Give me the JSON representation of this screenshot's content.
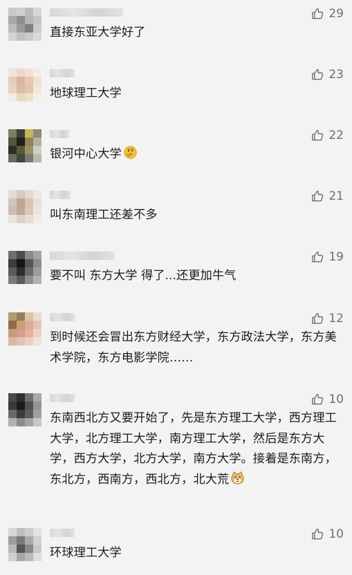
{
  "comments": [
    {
      "text": "直接东亚大学好了",
      "likes": "29",
      "emoji": "",
      "avatar": [
        "#c9c9c9",
        "#cfcfcf",
        "#bdbdbd",
        "#d6d6d6",
        "#a9a9a9",
        "#8f8f8f",
        "#b5b5b5",
        "#c4c4c4",
        "#bcbcbc",
        "#9a9a9a",
        "#7f7f7f",
        "#cdcdcd",
        "#d4d4d4",
        "#c1c1c1",
        "#cacaca",
        "#dadada"
      ]
    },
    {
      "text": "地球理工大学",
      "likes": "23",
      "emoji": "",
      "avatar": [
        "#f1e4d6",
        "#efd8c8",
        "#f3e1d3",
        "#f5ece2",
        "#e8ccb8",
        "#d9b39c",
        "#e6c9b3",
        "#f1e0d1",
        "#ecd3c0",
        "#dcbaa3",
        "#e3c4ad",
        "#f2e6da",
        "#f4ebe2",
        "#ead6c5",
        "#efdfcf",
        "#f6efe7"
      ]
    },
    {
      "text": "银河中心大学",
      "likes": "22",
      "emoji": "thinking-emoji",
      "avatar": [
        "#7b7b68",
        "#3e3e35",
        "#c9b65c",
        "#8a8a7a",
        "#55553f",
        "#1f1f18",
        "#8c8455",
        "#b1b1a0",
        "#2e2e25",
        "#5a5a3a",
        "#9a9160",
        "#cfcfc4",
        "#6a6a60",
        "#444438",
        "#7a7a6e",
        "#b8b8ad"
      ]
    },
    {
      "text": "叫东南理工还差不多",
      "likes": "21",
      "emoji": "",
      "avatar": [
        "#e1dcd6",
        "#d8c8bd",
        "#e4d8cf",
        "#ece8e4",
        "#d3c3b8",
        "#bfa796",
        "#d9c4b4",
        "#e6e0da",
        "#cdbdb1",
        "#c4a895",
        "#d8c7ba",
        "#ebe6e1",
        "#e9e4df",
        "#ded3c9",
        "#e6ddd5",
        "#efece9"
      ]
    },
    {
      "text": "要不叫 东方大学 得了...还更加牛气",
      "likes": "19",
      "emoji": "",
      "avatar": [
        "#6d6d6d",
        "#4b4b4b",
        "#8a8a8a",
        "#a4a4a4",
        "#3b3b3b",
        "#141414",
        "#555555",
        "#8c8c8c",
        "#5a5a5a",
        "#2d2d2d",
        "#6b6b6b",
        "#9c9c9c",
        "#7a7a7a",
        "#5b5b5b",
        "#8e8e8e",
        "#b2b2b2"
      ]
    },
    {
      "text": "到时候还会冒出东方财经大学，东方政法大学，东方美术学院，东方电影学院……",
      "likes": "12",
      "emoji": "",
      "avatar": [
        "#b59a6e",
        "#9a7c59",
        "#d9c8a8",
        "#e8ddd0",
        "#8e6b4c",
        "#c7a072",
        "#e0a998",
        "#e3c4b5",
        "#c89b80",
        "#d89a8c",
        "#e7b0a3",
        "#ead2c8",
        "#dcb5a4",
        "#e5c0b2",
        "#ecd0c4",
        "#f1e2da"
      ]
    },
    {
      "text": "东南西北方又要开始了，先是东方理工大学，西方理工大学，北方理工大学，南方理工大学，然后是东方大学，西方大学，北方大学，南方大学。接着是东南方，东北方，西南方，西北方，北大荒",
      "likes": "10",
      "emoji": "doge-emoji",
      "avatar": [
        "#4a4a4a",
        "#2f2f2f",
        "#6e6e6e",
        "#a8a8a8",
        "#3a3a3a",
        "#1c1c1c",
        "#515151",
        "#959595",
        "#6a6a6a",
        "#3c3c3c",
        "#5c5c5c",
        "#9f9f9f",
        "#b1b1b1",
        "#8c8c8c",
        "#a3a3a3",
        "#c7c7c7"
      ]
    },
    {
      "text": "环球理工大学",
      "likes": "10",
      "emoji": "",
      "avatar": [
        "#d7d7d7",
        "#bdbdbd",
        "#cccccc",
        "#e1e1e1",
        "#9c9c9c",
        "#7a7a7a",
        "#a9a9a9",
        "#d0d0d0",
        "#b8b8b8",
        "#555555",
        "#888888",
        "#c8c8c8",
        "#cfcfcf",
        "#a6a6a6",
        "#bbbbbb",
        "#dddddd"
      ]
    }
  ]
}
